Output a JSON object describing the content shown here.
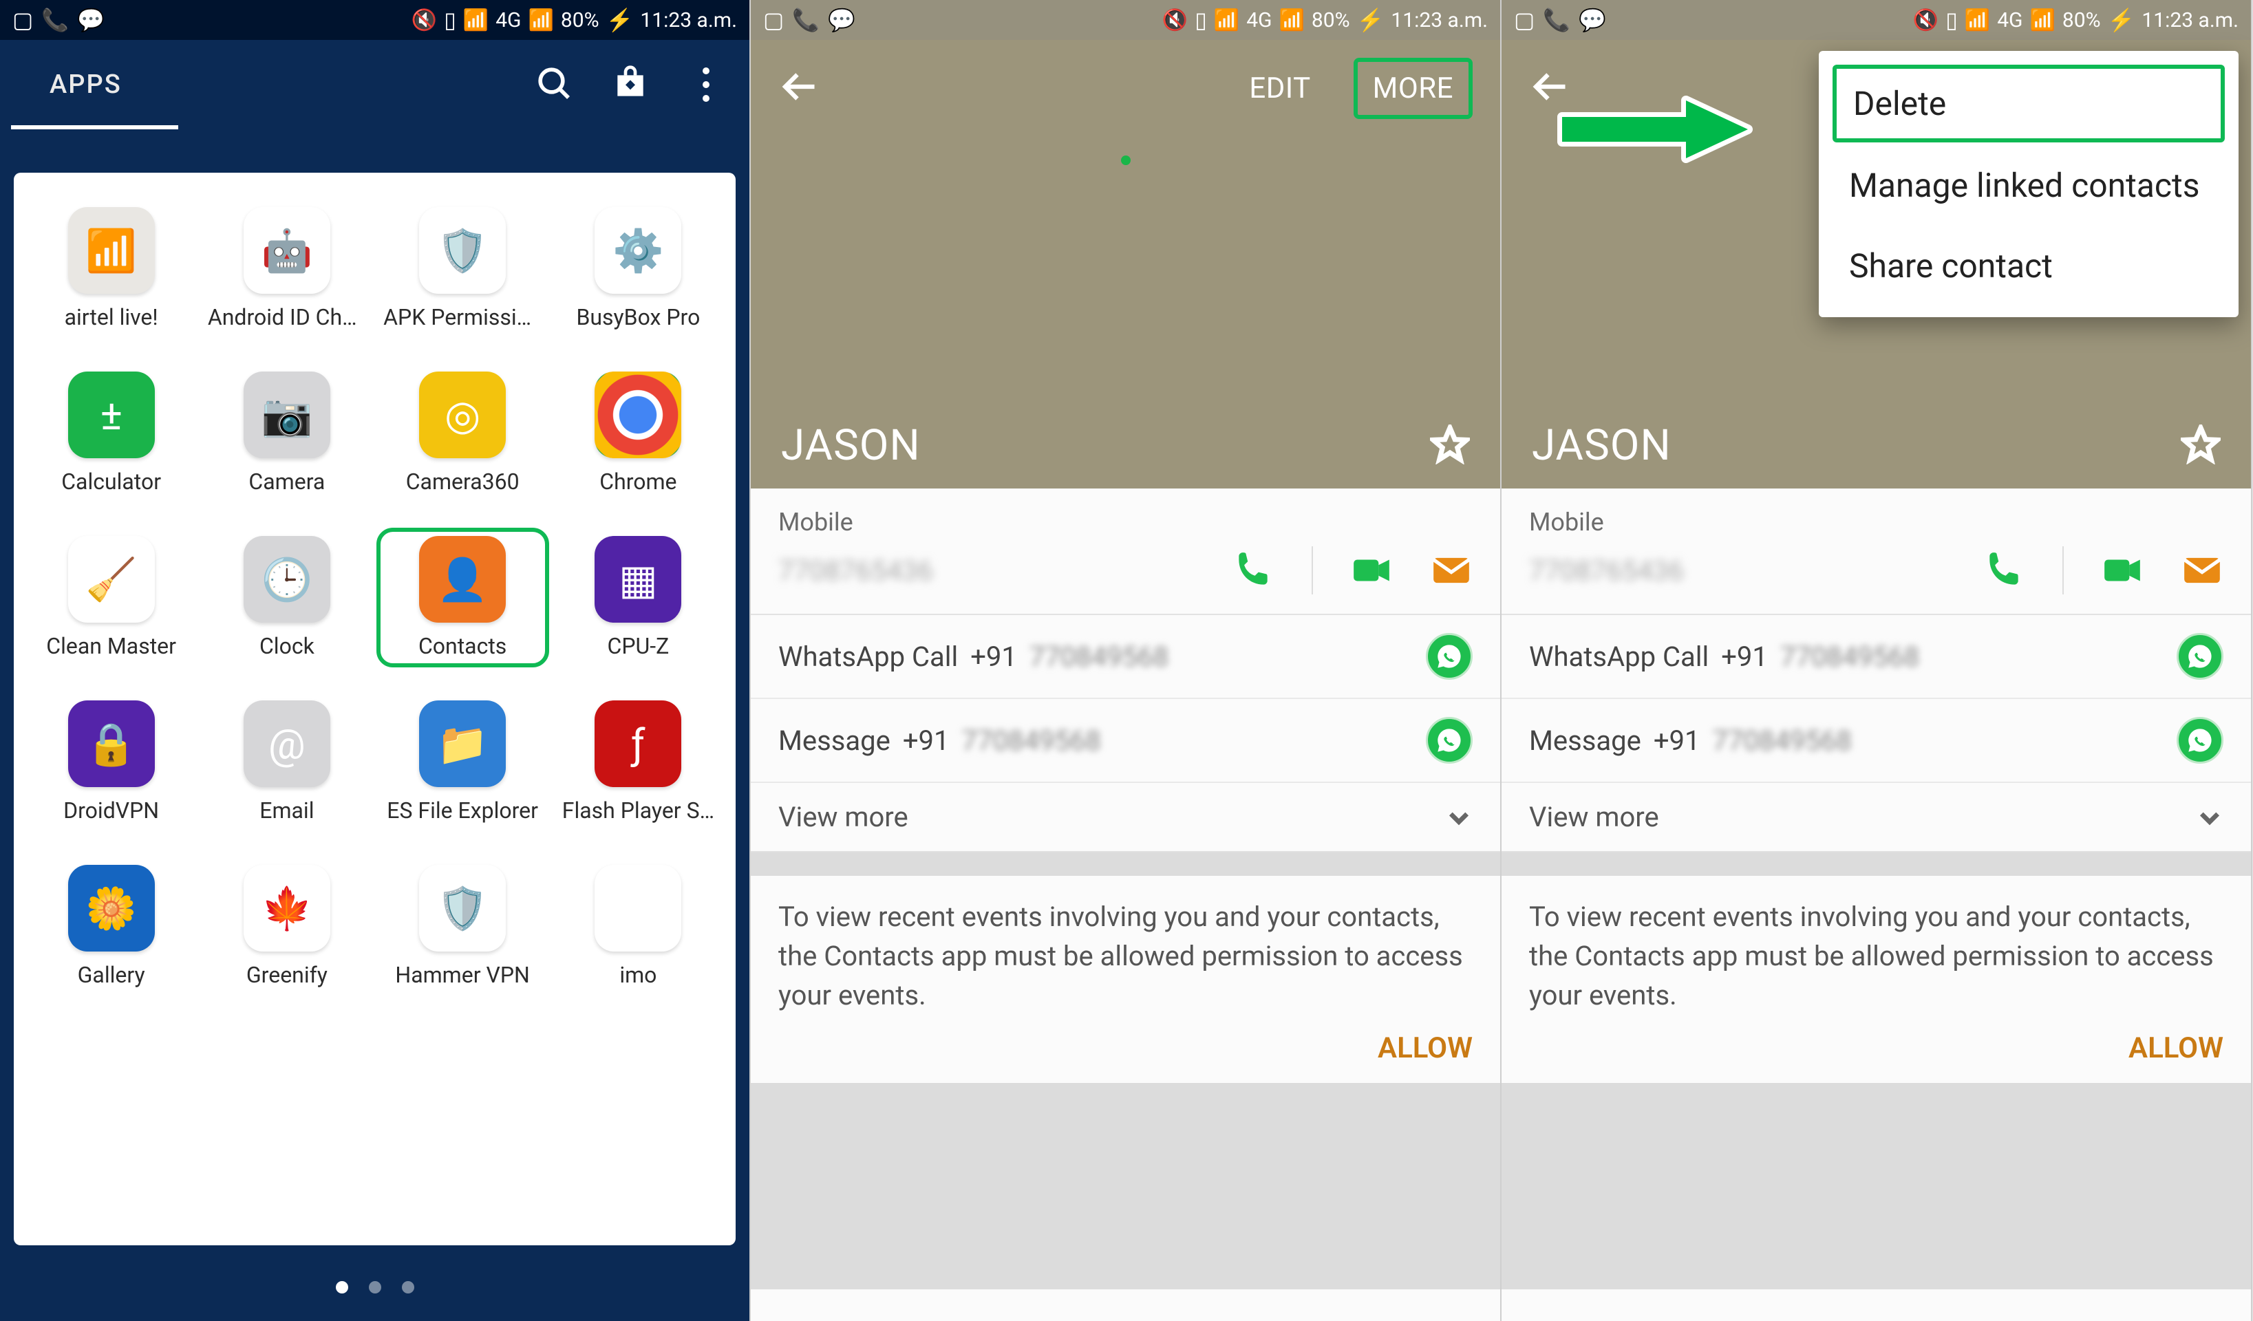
{
  "status": {
    "battery": "80%",
    "time": "11:23 a.m.",
    "net": "4G"
  },
  "screen1": {
    "tab": "APPS",
    "apps": [
      {
        "name": "airtel live!"
      },
      {
        "name": "Android ID Cha…"
      },
      {
        "name": "APK Permissio…"
      },
      {
        "name": "BusyBox Pro"
      },
      {
        "name": "Calculator"
      },
      {
        "name": "Camera"
      },
      {
        "name": "Camera360"
      },
      {
        "name": "Chrome"
      },
      {
        "name": "Clean Master"
      },
      {
        "name": "Clock"
      },
      {
        "name": "Contacts",
        "highlight": true
      },
      {
        "name": "CPU-Z"
      },
      {
        "name": "DroidVPN"
      },
      {
        "name": "Email"
      },
      {
        "name": "ES File Explorer"
      },
      {
        "name": "Flash Player S…"
      },
      {
        "name": "Gallery"
      },
      {
        "name": "Greenify"
      },
      {
        "name": "Hammer VPN"
      },
      {
        "name": "imo"
      }
    ]
  },
  "contact": {
    "edit": "EDIT",
    "more": "MORE",
    "name": "JASON",
    "mobile_label": "Mobile",
    "whatsapp_call": "WhatsApp Call",
    "whatsapp_call_prefix": "+91",
    "message_label": "Message",
    "message_prefix": "+91",
    "view_more": "View more",
    "permission_text": "To view recent events involving you and your contacts, the Contacts app must be allowed permission to access your events.",
    "allow": "ALLOW"
  },
  "popup": {
    "delete": "Delete",
    "manage": "Manage linked contacts",
    "share": "Share contact"
  }
}
